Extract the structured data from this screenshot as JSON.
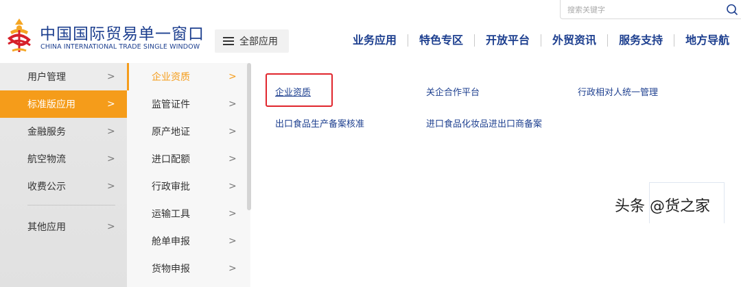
{
  "header": {
    "logo_cn": "中国国际贸易单一窗口",
    "logo_en": "CHINA INTERNATIONAL TRADE SINGLE WINDOW",
    "search_placeholder": "搜索关键字",
    "all_apps_label": "全部应用",
    "nav": [
      "业务应用",
      "特色专区",
      "开放平台",
      "外贸资讯",
      "服务支持",
      "地方导航"
    ]
  },
  "menu": {
    "level1": [
      {
        "label": "用户管理",
        "chev": ">"
      },
      {
        "label": "标准版应用",
        "chev": ">"
      },
      {
        "label": "金融服务",
        "chev": ">"
      },
      {
        "label": "航空物流",
        "chev": ">"
      },
      {
        "label": "收费公示",
        "chev": ">"
      },
      {
        "label": "其他应用",
        "chev": ">"
      }
    ],
    "level1_active": "标准版应用",
    "level2": [
      {
        "label": "企业资质",
        "chev": ">"
      },
      {
        "label": "监管证件",
        "chev": ">"
      },
      {
        "label": "原产地证",
        "chev": ">"
      },
      {
        "label": "进口配额",
        "chev": ">"
      },
      {
        "label": "行政审批",
        "chev": ">"
      },
      {
        "label": "运输工具",
        "chev": ">"
      },
      {
        "label": "舱单申报",
        "chev": ">"
      },
      {
        "label": "货物申报",
        "chev": ">"
      }
    ],
    "level2_active": "企业资质",
    "level3": [
      {
        "label": "企业资质"
      },
      {
        "label": "关企合作平台"
      },
      {
        "label": "行政相对人统一管理"
      },
      {
        "label": "出口食品生产备案核准"
      },
      {
        "label": "进口食品化妆品进出口商备案"
      }
    ]
  },
  "watermark": "头条 @货之家",
  "colors": {
    "brand_blue": "#1d3f8f",
    "accent_orange": "#f59c1a",
    "highlight_red": "#e0242b"
  }
}
